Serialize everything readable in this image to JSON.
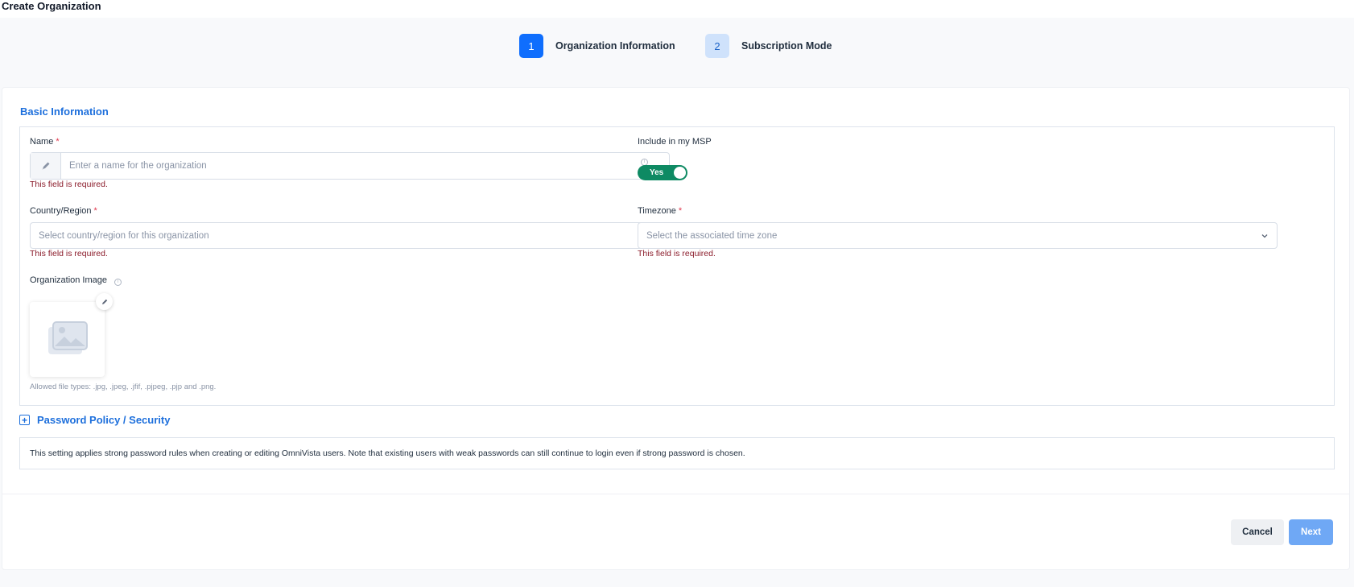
{
  "page": {
    "title": "Create Organization"
  },
  "stepper": {
    "steps": [
      {
        "number": "1",
        "label": "Organization Information",
        "state": "active"
      },
      {
        "number": "2",
        "label": "Subscription Mode",
        "state": "inactive"
      }
    ]
  },
  "basic_info": {
    "title": "Basic Information",
    "name": {
      "label": "Name",
      "required_marker": "*",
      "placeholder": "Enter a name for the organization",
      "value": "",
      "error": "This field is required.",
      "prefix_icon": "pencil-icon"
    },
    "msp": {
      "label": "Include in my MSP",
      "info_icon": "i",
      "toggle_label": "Yes",
      "toggle_on": true
    },
    "country": {
      "label": "Country/Region",
      "required_marker": "*",
      "placeholder": "Select country/region for this organization",
      "error": "This field is required."
    },
    "timezone": {
      "label": "Timezone",
      "required_marker": "*",
      "placeholder": "Select the associated time zone",
      "error": "This field is required."
    },
    "image": {
      "label": "Organization Image",
      "info_icon": "i",
      "hint": "Allowed file types: .jpg, .jpeg, .jfif, .pjpeg, .pjp and .png."
    }
  },
  "password_policy": {
    "expand_icon": "+",
    "title": "Password Policy / Security",
    "description": "This setting applies strong password rules when creating or editing OmniVista users. Note that existing users with weak passwords can still continue to login even if strong password is chosen."
  },
  "footer": {
    "cancel_label": "Cancel",
    "next_label": "Next"
  },
  "colors": {
    "primary": "#0f6efd",
    "link_blue": "#1d6fdc",
    "toggle_green": "#0e8a63",
    "error_red": "#8b1c2b",
    "next_disabled": "#6fa8f5"
  }
}
